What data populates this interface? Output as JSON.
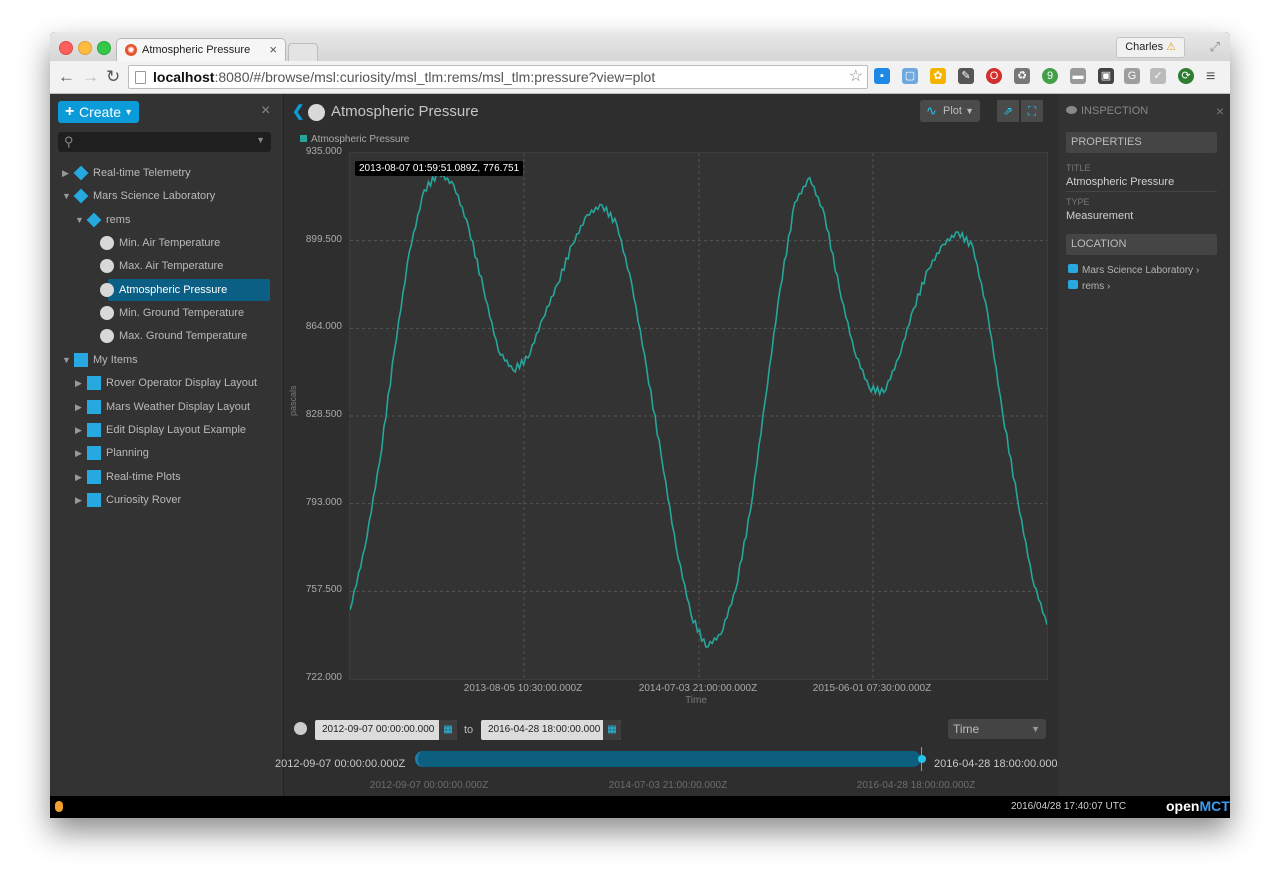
{
  "browser": {
    "tab_title": "Atmospheric Pressure",
    "profile": "Charles",
    "url_host": "localhost",
    "url_rest": ":8080/#/browse/msl:curiosity/msl_tlm:rems/msl_tlm:pressure?view=plot"
  },
  "left": {
    "create_label": "Create",
    "tree": [
      {
        "label": "Real-time Telemetry",
        "icon": "telemetry-icon"
      },
      {
        "label": "Mars Science Laboratory",
        "icon": "telemetry-icon"
      },
      {
        "label": "rems",
        "icon": "telemetry-icon"
      },
      {
        "label": "Min. Air Temperature",
        "icon": "telemetry-point-icon"
      },
      {
        "label": "Max. Air Temperature",
        "icon": "telemetry-point-icon"
      },
      {
        "label": "Atmospheric Pressure",
        "icon": "telemetry-point-icon"
      },
      {
        "label": "Min. Ground Temperature",
        "icon": "telemetry-point-icon"
      },
      {
        "label": "Max. Ground Temperature",
        "icon": "telemetry-point-icon"
      },
      {
        "label": "My Items",
        "icon": "folder-icon"
      },
      {
        "label": "Rover Operator Display Layout",
        "icon": "layout-icon"
      },
      {
        "label": "Mars Weather Display Layout",
        "icon": "layout-icon"
      },
      {
        "label": "Edit Display Layout Example",
        "icon": "layout-icon"
      },
      {
        "label": "Planning",
        "icon": "folder-icon"
      },
      {
        "label": "Real-time Plots",
        "icon": "folder-icon"
      },
      {
        "label": "Curiosity Rover",
        "icon": "folder-icon"
      }
    ]
  },
  "main": {
    "title": "Atmospheric Pressure",
    "view_label": "Plot",
    "tooltip": "2013-08-07 01:59:51.089Z, 776.751",
    "time": {
      "start": "2012-09-07 00:00:00.000",
      "to": "to",
      "end": "2016-04-28 18:00:00.000",
      "system": "Time",
      "range_start": "2012-09-07 00:00:00.000Z",
      "range_end": "2016-04-28 18:00:00.000Z",
      "ticks": [
        "2012-09-07 00:00:00.000Z",
        "2014-07-03 21:00:00.000Z",
        "2016-04-28 18:00:00.000Z"
      ]
    }
  },
  "chart_data": {
    "type": "line",
    "xlabel": "Time",
    "ylabel": "pascals",
    "ylim": [
      722.0,
      935.0
    ],
    "y_ticks": [
      "935.000",
      "899.500",
      "864.000",
      "828.500",
      "793.000",
      "757.500",
      "722.000"
    ],
    "x_ticks": [
      "2013-08-05 10:30:00.000Z",
      "2014-07-03 21:00:00.000Z",
      "2015-06-01 07:30:00.000Z"
    ],
    "grid": true,
    "legend_position": "top-left",
    "series": [
      {
        "name": "Atmospheric Pressure",
        "color": "#26a69a",
        "points": [
          [
            0.0,
            750
          ],
          [
            0.015,
            775
          ],
          [
            0.03,
            810
          ],
          [
            0.045,
            855
          ],
          [
            0.06,
            895
          ],
          [
            0.075,
            920
          ],
          [
            0.09,
            927
          ],
          [
            0.105,
            922
          ],
          [
            0.12,
            905
          ],
          [
            0.135,
            880
          ],
          [
            0.15,
            855
          ],
          [
            0.165,
            847
          ],
          [
            0.18,
            852
          ],
          [
            0.195,
            868
          ],
          [
            0.21,
            882
          ],
          [
            0.225,
            898
          ],
          [
            0.24,
            910
          ],
          [
            0.255,
            914
          ],
          [
            0.27,
            906
          ],
          [
            0.285,
            882
          ],
          [
            0.3,
            848
          ],
          [
            0.315,
            812
          ],
          [
            0.33,
            775
          ],
          [
            0.345,
            748
          ],
          [
            0.36,
            735
          ],
          [
            0.375,
            740
          ],
          [
            0.39,
            758
          ],
          [
            0.405,
            790
          ],
          [
            0.42,
            835
          ],
          [
            0.435,
            880
          ],
          [
            0.45,
            915
          ],
          [
            0.465,
            925
          ],
          [
            0.48,
            910
          ],
          [
            0.495,
            880
          ],
          [
            0.51,
            855
          ],
          [
            0.525,
            840
          ],
          [
            0.54,
            838
          ],
          [
            0.555,
            852
          ],
          [
            0.57,
            872
          ],
          [
            0.585,
            888
          ],
          [
            0.6,
            898
          ],
          [
            0.615,
            903
          ],
          [
            0.63,
            897
          ],
          [
            0.645,
            870
          ],
          [
            0.66,
            830
          ],
          [
            0.675,
            795
          ],
          [
            0.69,
            763
          ],
          [
            0.705,
            744
          ]
        ]
      }
    ]
  },
  "inspector": {
    "header": "INSPECTION",
    "properties_header": "PROPERTIES",
    "title_label": "TITLE",
    "title_value": "Atmospheric Pressure",
    "type_label": "TYPE",
    "type_value": "Measurement",
    "location_header": "LOCATION",
    "location": [
      "Mars Science Laboratory",
      "rems"
    ]
  },
  "status": {
    "clock": "2016/04/28 17:40:07 UTC",
    "logo_a": "open",
    "logo_b": "MCT"
  },
  "colors": {
    "accent": "#0a9bd8",
    "series": "#26a69a",
    "selected": "#0b5f84"
  }
}
